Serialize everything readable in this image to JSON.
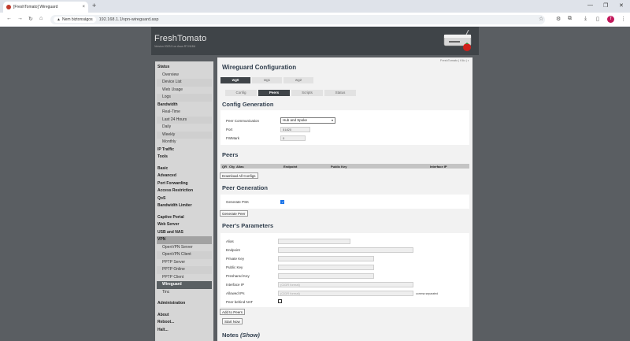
{
  "browser": {
    "tab_title": "[FreshTomato] Wireguard",
    "security": "Nem biztonságos",
    "url": "192.168.1.1/vpn-wireguard.asp",
    "profile_initial": "T"
  },
  "header": {
    "logo": "FreshTomato",
    "version": "Version 2023.5 on Asus RT-N18U"
  },
  "top_right": "FreshTomato | Kilo | ◐",
  "sidebar": {
    "items": [
      {
        "label": "Status",
        "type": "section"
      },
      {
        "label": "Overview",
        "type": "sub"
      },
      {
        "label": "Device List",
        "type": "sub"
      },
      {
        "label": "Web Usage",
        "type": "sub"
      },
      {
        "label": "Logs",
        "type": "sub"
      },
      {
        "label": "Bandwidth",
        "type": "section"
      },
      {
        "label": "Real-Time",
        "type": "sub"
      },
      {
        "label": "Last 24 Hours",
        "type": "sub"
      },
      {
        "label": "Daily",
        "type": "sub"
      },
      {
        "label": "Weekly",
        "type": "sub"
      },
      {
        "label": "Monthly",
        "type": "sub"
      },
      {
        "label": "IP Traffic",
        "type": "section"
      },
      {
        "label": "Tools",
        "type": "section"
      },
      {
        "label": "Basic",
        "type": "section"
      },
      {
        "label": "Advanced",
        "type": "section"
      },
      {
        "label": "Port Forwarding",
        "type": "section"
      },
      {
        "label": "Access Restriction",
        "type": "section"
      },
      {
        "label": "QoS",
        "type": "section"
      },
      {
        "label": "Bandwidth Limiter",
        "type": "section"
      },
      {
        "label": "Captive Portal",
        "type": "section"
      },
      {
        "label": "Web Server",
        "type": "section"
      },
      {
        "label": "USB and NAS",
        "type": "section"
      },
      {
        "label": "VPN",
        "type": "active"
      },
      {
        "label": "OpenVPN Server",
        "type": "sub"
      },
      {
        "label": "OpenVPN Client",
        "type": "sub"
      },
      {
        "label": "PPTP Server",
        "type": "sub"
      },
      {
        "label": "PPTP Online",
        "type": "sub"
      },
      {
        "label": "PPTP Client",
        "type": "sub"
      },
      {
        "label": "Wireguard",
        "type": "selected"
      },
      {
        "label": "Tinc",
        "type": "sub"
      },
      {
        "label": "Administration",
        "type": "section"
      },
      {
        "label": "About",
        "type": "section"
      },
      {
        "label": "Reboot...",
        "type": "section"
      },
      {
        "label": "Halt...",
        "type": "section"
      }
    ]
  },
  "main": {
    "title": "Wireguard Configuration",
    "iface_tabs": [
      "wg0",
      "wg1",
      "wg2"
    ],
    "sub_tabs": [
      "Config",
      "Peers",
      "Scripts",
      "Status"
    ],
    "config_gen": {
      "title": "Config Generation",
      "peer_comm_label": "Peer Communication",
      "peer_comm_value": "Hub and Spoke",
      "port_label": "Port",
      "port_value": "51820",
      "fwmark_label": "FWMark",
      "fwmark_value": "0"
    },
    "peers": {
      "title": "Peers",
      "columns": [
        "QR",
        "Cfg",
        "Alias",
        "Endpoint",
        "Public Key",
        "Interface IP"
      ],
      "download_btn": "Download All Configs"
    },
    "peer_gen": {
      "title": "Peer Generation",
      "psk_label": "Generate PSK",
      "generate_btn": "Generate Peer"
    },
    "peer_params": {
      "title": "Peer's Parameters",
      "alias_label": "Alias",
      "endpoint_label": "Endpoint",
      "private_key_label": "Private Key",
      "public_key_label": "Public Key",
      "preshared_key_label": "Preshared Key",
      "interface_ip_label": "Interface IP",
      "interface_ip_placeholder": "(CIDR format)",
      "allowed_ips_label": "Allowed IPs",
      "allowed_ips_placeholder": "(CIDR format)",
      "allowed_ips_note": "comma separated",
      "behind_nat_label": "Peer behind NAT",
      "add_btn": "Add to Peers",
      "start_btn": "Start Now"
    },
    "notes": {
      "title": "Notes",
      "show": "(Show)"
    }
  }
}
